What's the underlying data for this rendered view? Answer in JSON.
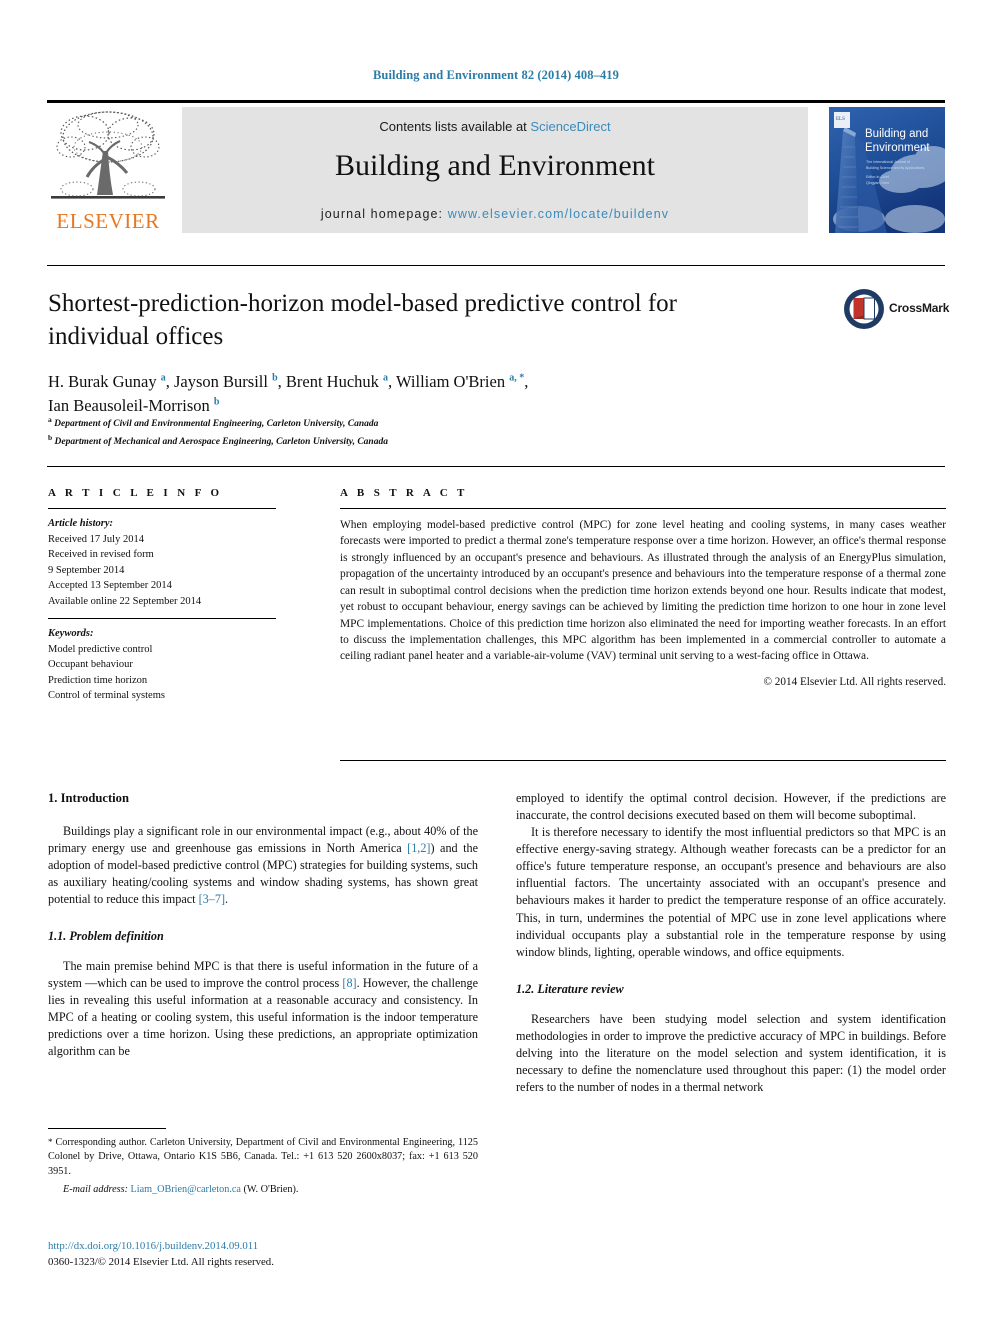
{
  "running_head": "Building and Environment 82 (2014) 408–419",
  "masthead": {
    "publisher_name": "ELSEVIER",
    "contents_prefix": "Contents lists available at ",
    "contents_link": "ScienceDirect",
    "journal_name": "Building and Environment",
    "homepage_prefix": "journal homepage: ",
    "homepage_link": "www.elsevier.com/locate/buildenv",
    "cover_title_line1": "Building and",
    "cover_title_line2": "Environment",
    "cover_sub_line1": "The International Journal of",
    "cover_sub_line2": "Building Science and its Applications",
    "cover_sub_line3": "Editor-in-Chief",
    "cover_sub_line4": "Qingyan Chen",
    "link_color": "#3a8bbb",
    "elsevier_orange": "#e87722"
  },
  "title": "Shortest-prediction-horizon model-based predictive control for individual offices",
  "authors": [
    {
      "name": "H. Burak Gunay",
      "marks": "a"
    },
    {
      "name": "Jayson Bursill",
      "marks": "b"
    },
    {
      "name": "Brent Huchuk",
      "marks": "a"
    },
    {
      "name": "William O'Brien",
      "marks": "a, *"
    },
    {
      "name": "Ian Beausoleil-Morrison",
      "marks": "b"
    }
  ],
  "affiliations": [
    {
      "mark": "a",
      "text": "Department of Civil and Environmental Engineering, Carleton University, Canada"
    },
    {
      "mark": "b",
      "text": "Department of Mechanical and Aerospace Engineering, Carleton University, Canada"
    }
  ],
  "crossmark": {
    "label": "CrossMark"
  },
  "article_info": {
    "heading": "A R T I C L E   I N F O",
    "history_label": "Article history:",
    "history": [
      "Received 17 July 2014",
      "Received in revised form",
      "9 September 2014",
      "Accepted 13 September 2014",
      "Available online 22 September 2014"
    ],
    "keywords_label": "Keywords:",
    "keywords": [
      "Model predictive control",
      "Occupant behaviour",
      "Prediction time horizon",
      "Control of terminal systems"
    ]
  },
  "abstract": {
    "heading": "A B S T R A C T",
    "text": "When employing model-based predictive control (MPC) for zone level heating and cooling systems, in many cases weather forecasts were imported to predict a thermal zone's temperature response over a time horizon. However, an office's thermal response is strongly influenced by an occupant's presence and behaviours. As illustrated through the analysis of an EnergyPlus simulation, propagation of the uncertainty introduced by an occupant's presence and behaviours into the temperature response of a thermal zone can result in suboptimal control decisions when the prediction time horizon extends beyond one hour. Results indicate that modest, yet robust to occupant behaviour, energy savings can be achieved by limiting the prediction time horizon to one hour in zone level MPC implementations. Choice of this prediction time horizon also eliminated the need for importing weather forecasts. In an effort to discuss the implementation challenges, this MPC algorithm has been implemented in a commercial controller to automate a ceiling radiant panel heater and a variable-air-volume (VAV) terminal unit serving to a west-facing office in Ottawa.",
    "copyright": "© 2014 Elsevier Ltd. All rights reserved."
  },
  "body": {
    "left": {
      "section_heading": "1. Introduction",
      "para1_a": "Buildings play a significant role in our environmental impact (e.g., about 40% of the primary energy use and greenhouse gas emissions in North America ",
      "para1_ref1": "[1,2]",
      "para1_b": ") and the adoption of model-based predictive control (MPC) strategies for building systems, such as auxiliary heating/cooling systems and window shading systems, has shown great potential to reduce this impact ",
      "para1_ref2": "[3–7]",
      "para1_c": ".",
      "subsection_heading": "1.1. Problem definition",
      "para2_a": "The main premise behind MPC is that there is useful information in the future of a system —which can be used to improve the control process ",
      "para2_ref": "[8]",
      "para2_b": ". However, the challenge lies in revealing this useful information at a reasonable accuracy and consistency. In MPC of a heating or cooling system, this useful information is the indoor temperature predictions over a time horizon. Using these predictions, an appropriate optimization algorithm can be"
    },
    "right": {
      "para1": "employed to identify the optimal control decision. However, if the predictions are inaccurate, the control decisions executed based on them will become suboptimal.",
      "para2": "It is therefore necessary to identify the most influential predictors so that MPC is an effective energy-saving strategy. Although weather forecasts can be a predictor for an office's future temperature response, an occupant's presence and behaviours are also influential factors. The uncertainty associated with an occupant's presence and behaviours makes it harder to predict the temperature response of an office accurately. This, in turn, undermines the potential of MPC use in zone level applications where individual occupants play a substantial role in the temperature response by using window blinds, lighting, operable windows, and office equipments.",
      "subsection_heading": "1.2. Literature review",
      "para3": "Researchers have been studying model selection and system identification methodologies in order to improve the predictive accuracy of MPC in buildings. Before delving into the literature on the model selection and system identification, it is necessary to define the nomenclature used throughout this paper: (1) the model order refers to the number of nodes in a thermal network"
    }
  },
  "footnote": {
    "star": "*",
    "text": " Corresponding author. Carleton University, Department of Civil and Environmental Engineering, 1125 Colonel by Drive, Ottawa, Ontario K1S 5B6, Canada. Tel.: +1 613 520 2600x8037; fax: +1 613 520 3951.",
    "email_label": "E-mail address:",
    "email": "Liam_OBrien@carleton.ca",
    "email_suffix": "(W. O'Brien)."
  },
  "doi": {
    "url": "http://dx.doi.org/10.1016/j.buildenv.2014.09.011",
    "issn_line": "0360-1323/© 2014 Elsevier Ltd. All rights reserved."
  }
}
